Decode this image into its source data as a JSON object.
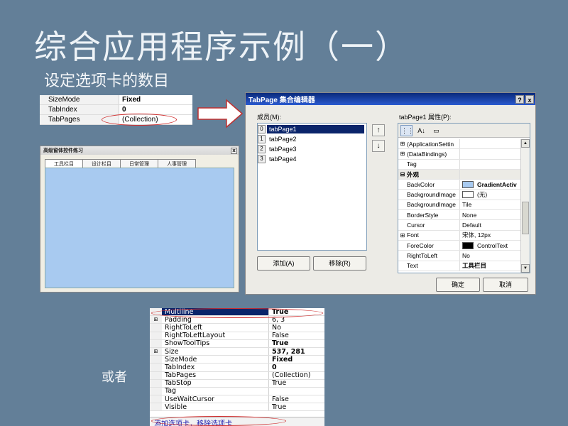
{
  "title": "综合应用程序示例（一）",
  "subtitle": "设定选项卡的数目",
  "or_text": "或者",
  "grid_small": {
    "rows": [
      {
        "name": "SizeMode",
        "value": "Fixed",
        "bold": true
      },
      {
        "name": "TabIndex",
        "value": "0",
        "bold": true
      },
      {
        "name": "TabPages",
        "value": "(Collection)",
        "bold": false
      }
    ]
  },
  "form_preview": {
    "title": "高级窗体控件练习",
    "close": "x",
    "tabs": [
      "工具栏目",
      "设计栏目",
      "日常管理",
      "人事管理"
    ]
  },
  "dialog": {
    "title": "TabPage 集合编辑器",
    "help_btn": "?",
    "close_btn": "x",
    "members_label": "成员(M):",
    "members": [
      {
        "index": "0",
        "name": "tabPage1"
      },
      {
        "index": "1",
        "name": "tabPage2"
      },
      {
        "index": "2",
        "name": "tabPage3"
      },
      {
        "index": "3",
        "name": "tabPage4"
      }
    ],
    "up_btn": "↑",
    "down_btn": "↓",
    "add_btn": "添加(A)",
    "remove_btn": "移除(R)",
    "props_label": "tabPage1 属性(P):",
    "properties": [
      {
        "mark": "⊞",
        "name": "(ApplicationSettin",
        "value": "",
        "category": false
      },
      {
        "mark": "⊞",
        "name": "(DataBindings)",
        "value": "",
        "category": false
      },
      {
        "mark": "",
        "name": "Tag",
        "value": "",
        "category": false
      },
      {
        "mark": "⊟",
        "name": "外观",
        "value": "",
        "category": true
      },
      {
        "mark": "",
        "name": "BackColor",
        "value": "GradientActiv",
        "swatch": "#a8caf0",
        "boldval": true
      },
      {
        "mark": "",
        "name": "BackgroundImage",
        "value": "(无)",
        "swatch": "#ffffff"
      },
      {
        "mark": "",
        "name": "BackgroundImage",
        "value": "Tile"
      },
      {
        "mark": "",
        "name": "BorderStyle",
        "value": "None"
      },
      {
        "mark": "",
        "name": "Cursor",
        "value": "Default"
      },
      {
        "mark": "⊞",
        "name": "Font",
        "value": "宋体, 12px"
      },
      {
        "mark": "",
        "name": "ForeColor",
        "value": "ControlText",
        "swatch": "#000000"
      },
      {
        "mark": "",
        "name": "RightToLeft",
        "value": "No"
      },
      {
        "mark": "",
        "name": "Text",
        "value": "工具栏目",
        "boldval": true
      }
    ],
    "ok_btn": "确定",
    "cancel_btn": "取消"
  },
  "grid_large": {
    "rows": [
      {
        "mark": "",
        "name": "Multiline",
        "value": "True",
        "bold": true,
        "selected": true
      },
      {
        "mark": "⊞",
        "name": "Padding",
        "value": "6, 3"
      },
      {
        "mark": "",
        "name": "RightToLeft",
        "value": "No"
      },
      {
        "mark": "",
        "name": "RightToLeftLayout",
        "value": "False"
      },
      {
        "mark": "",
        "name": "ShowToolTips",
        "value": "True",
        "bold": true
      },
      {
        "mark": "⊞",
        "name": "Size",
        "value": "537, 281",
        "bold": true
      },
      {
        "mark": "",
        "name": "SizeMode",
        "value": "Fixed",
        "bold": true
      },
      {
        "mark": "",
        "name": "TabIndex",
        "value": "0",
        "bold": true
      },
      {
        "mark": "",
        "name": "TabPages",
        "value": "(Collection)"
      },
      {
        "mark": "",
        "name": "TabStop",
        "value": "True"
      },
      {
        "mark": "",
        "name": "Tag",
        "value": ""
      },
      {
        "mark": "",
        "name": "UseWaitCursor",
        "value": "False"
      },
      {
        "mark": "",
        "name": "Visible",
        "value": "True"
      }
    ],
    "footer_link": "添加选项卡，移除选项卡"
  }
}
